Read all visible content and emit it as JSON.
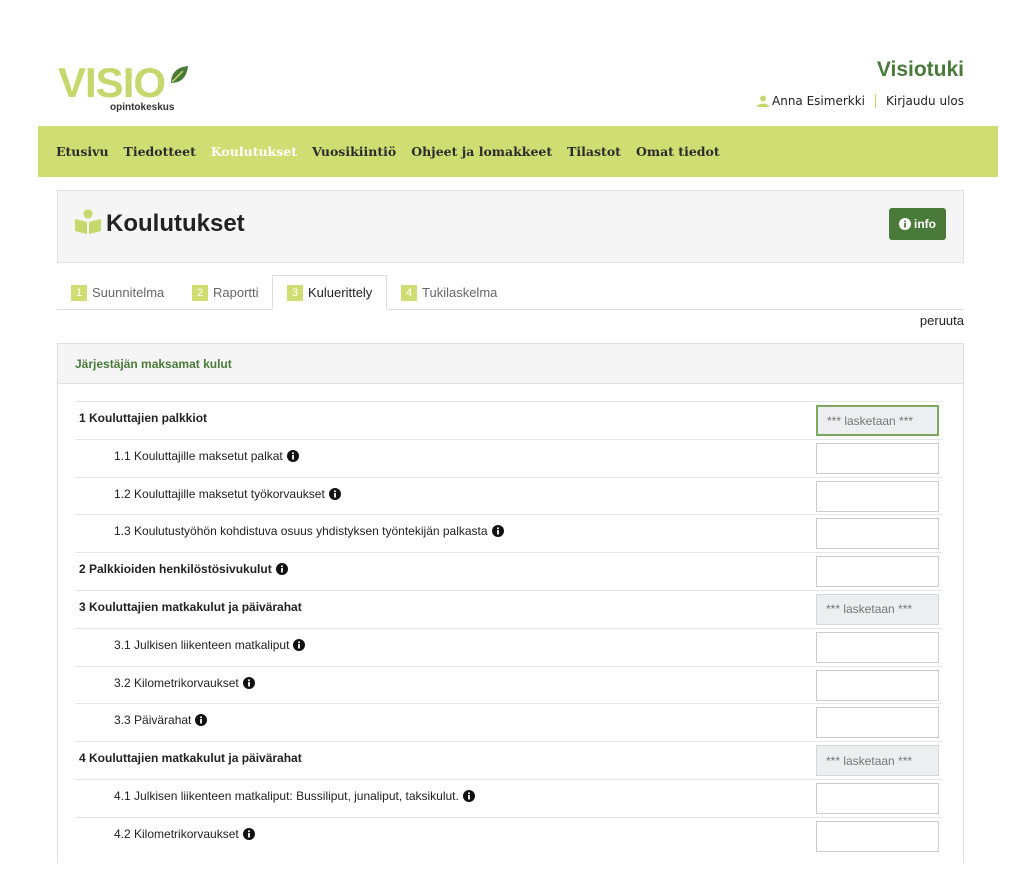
{
  "header": {
    "logo_text": "VISIO",
    "logo_subtext": "opintokeskus",
    "site_title": "Visiotuki",
    "user_name": "Anna Esimerkki",
    "logout_label": "Kirjaudu ulos"
  },
  "nav": {
    "items": [
      {
        "label": "Etusivu",
        "active": false
      },
      {
        "label": "Tiedotteet",
        "active": false
      },
      {
        "label": "Koulutukset",
        "active": true
      },
      {
        "label": "Vuosikiintiö",
        "active": false
      },
      {
        "label": "Ohjeet ja lomakkeet",
        "active": false
      },
      {
        "label": "Tilastot",
        "active": false
      },
      {
        "label": "Omat tiedot",
        "active": false
      }
    ]
  },
  "page": {
    "title": "Koulutukset",
    "info_label": "info"
  },
  "tabs": [
    {
      "num": "1",
      "label": "Suunnitelma",
      "active": false
    },
    {
      "num": "2",
      "label": "Raportti",
      "active": false
    },
    {
      "num": "3",
      "label": "Kuluerittely",
      "active": true
    },
    {
      "num": "4",
      "label": "Tukilaskelma",
      "active": false
    }
  ],
  "cancel_label": "peruuta",
  "costs": {
    "header": "Järjestäjän maksamat kulut",
    "calculated_placeholder": "*** lasketaan ***",
    "rows": [
      {
        "label": "1 Kouluttajien palkkiot",
        "level": "main",
        "info": false,
        "calculated": true,
        "focused": true
      },
      {
        "label": "1.1 Kouluttajille maksetut palkat",
        "level": "sub",
        "info": true,
        "calculated": false
      },
      {
        "label": "1.2 Kouluttajille maksetut työkorvaukset",
        "level": "sub",
        "info": true,
        "calculated": false
      },
      {
        "label": "1.3 Koulutustyöhön kohdistuva osuus yhdistyksen työntekijän palkasta",
        "level": "sub",
        "info": true,
        "calculated": false
      },
      {
        "label": "2 Palkkioiden henkilöstösivukulut",
        "level": "main",
        "info": true,
        "calculated": false
      },
      {
        "label": "3 Kouluttajien matkakulut ja päivärahat",
        "level": "main",
        "info": false,
        "calculated": true
      },
      {
        "label": "3.1 Julkisen liikenteen matkaliput",
        "level": "sub",
        "info": true,
        "calculated": false
      },
      {
        "label": "3.2 Kilometrikorvaukset",
        "level": "sub",
        "info": true,
        "calculated": false
      },
      {
        "label": "3.3 Päivärahat",
        "level": "sub",
        "info": true,
        "calculated": false
      },
      {
        "label": "4 Kouluttajien matkakulut ja päivärahat",
        "level": "main",
        "info": false,
        "calculated": true
      },
      {
        "label": "4.1 Julkisen liikenteen matkaliput: Bussiliput, junaliput, taksikulut.",
        "level": "sub",
        "info": true,
        "calculated": false
      },
      {
        "label": "4.2 Kilometrikorvaukset",
        "level": "sub",
        "info": true,
        "calculated": false
      }
    ]
  },
  "colors": {
    "brand_green": "#4a7a3a",
    "nav_lime": "#cfde72",
    "logo_lime": "#c5d86d"
  }
}
